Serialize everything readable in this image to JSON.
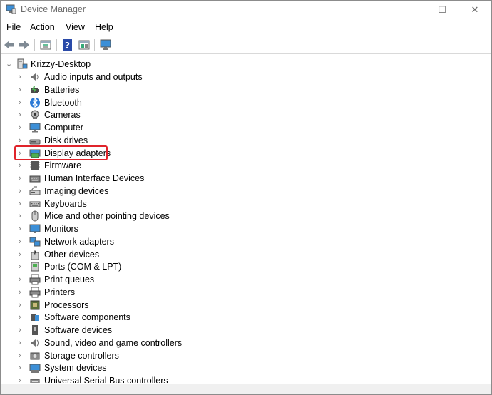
{
  "window": {
    "title": "Device Manager",
    "minimize": "—",
    "maximize": "☐",
    "close": "✕"
  },
  "menu": [
    "File",
    "Action",
    "View",
    "Help"
  ],
  "toolbar": [
    "back-icon",
    "forward-icon",
    "properties-icon",
    "help-icon",
    "details-icon",
    "monitor-icon"
  ],
  "tree": {
    "root": "Krizzy-Desktop",
    "items": [
      {
        "label": "Audio inputs and outputs",
        "icon": "speaker-icon"
      },
      {
        "label": "Batteries",
        "icon": "battery-icon"
      },
      {
        "label": "Bluetooth",
        "icon": "bluetooth-icon"
      },
      {
        "label": "Cameras",
        "icon": "camera-icon"
      },
      {
        "label": "Computer",
        "icon": "computer-icon"
      },
      {
        "label": "Disk drives",
        "icon": "disk-icon"
      },
      {
        "label": "Display adapters",
        "icon": "display-adapter-icon"
      },
      {
        "label": "Firmware",
        "icon": "firmware-icon"
      },
      {
        "label": "Human Interface Devices",
        "icon": "hid-icon"
      },
      {
        "label": "Imaging devices",
        "icon": "scanner-icon"
      },
      {
        "label": "Keyboards",
        "icon": "keyboard-icon"
      },
      {
        "label": "Mice and other pointing devices",
        "icon": "mouse-icon"
      },
      {
        "label": "Monitors",
        "icon": "monitor-icon"
      },
      {
        "label": "Network adapters",
        "icon": "network-icon"
      },
      {
        "label": "Other devices",
        "icon": "unknown-device-icon"
      },
      {
        "label": "Ports (COM & LPT)",
        "icon": "port-icon"
      },
      {
        "label": "Print queues",
        "icon": "print-queue-icon"
      },
      {
        "label": "Printers",
        "icon": "printer-icon"
      },
      {
        "label": "Processors",
        "icon": "processor-icon"
      },
      {
        "label": "Software components",
        "icon": "software-component-icon"
      },
      {
        "label": "Software devices",
        "icon": "software-device-icon"
      },
      {
        "label": "Sound, video and game controllers",
        "icon": "sound-icon"
      },
      {
        "label": "Storage controllers",
        "icon": "storage-icon"
      },
      {
        "label": "System devices",
        "icon": "system-icon"
      },
      {
        "label": "Universal Serial Bus controllers",
        "icon": "usb-icon"
      }
    ]
  },
  "colors": {
    "highlight": "#e0242b",
    "accent": "#2b79d6"
  }
}
